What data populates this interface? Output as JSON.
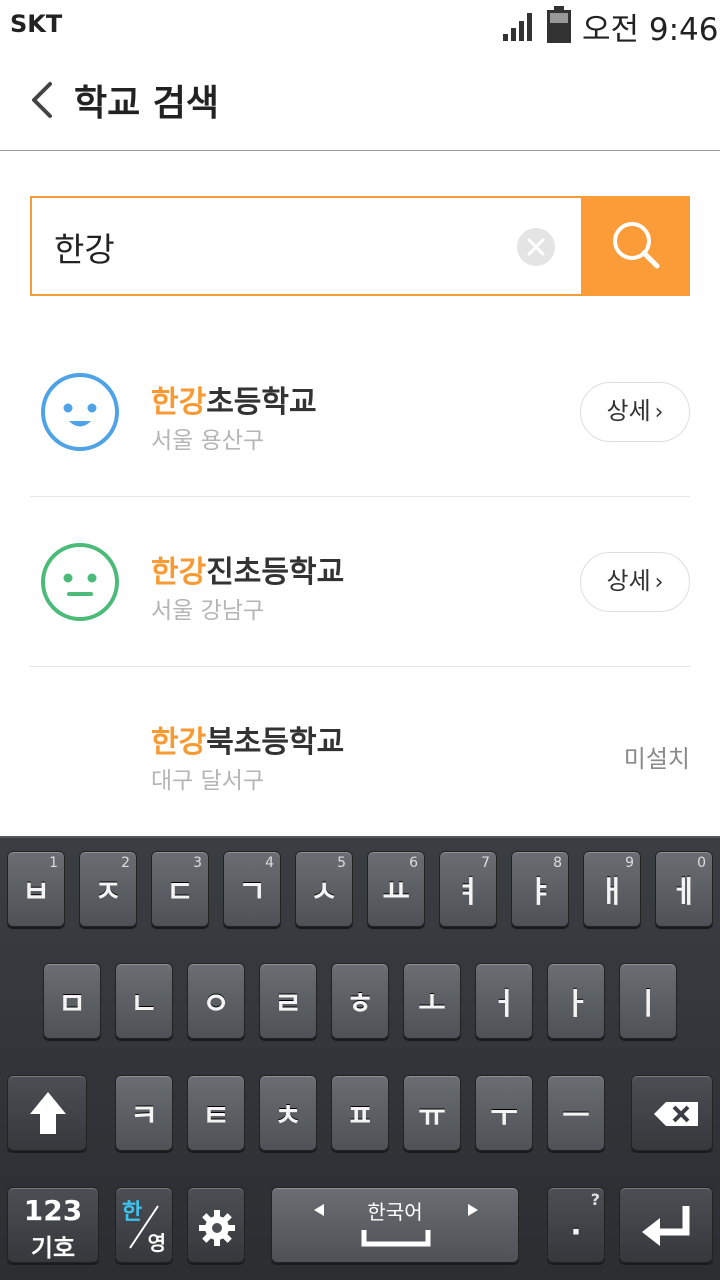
{
  "status_bar": {
    "carrier": "SKT",
    "time": "오전 9:46"
  },
  "header": {
    "title": "학교 검색"
  },
  "search": {
    "value": "한강",
    "placeholder": ""
  },
  "colors": {
    "accent": "#fb9c38",
    "happy_face": "#4ea2e6",
    "neutral_face": "#4cbb7a"
  },
  "results": [
    {
      "highlight": "한강",
      "rest": "초등학교",
      "district": "서울 용산구",
      "icon": "smiley-face-icon",
      "action": "상세",
      "status": ""
    },
    {
      "highlight": "한강",
      "rest": "진초등학교",
      "district": "서울 강남구",
      "icon": "neutral-face-icon",
      "action": "상세",
      "status": ""
    },
    {
      "highlight": "한강",
      "rest": "북초등학교",
      "district": "대구 달서구",
      "icon": "",
      "action": "",
      "status": "미설치"
    }
  ],
  "keyboard": {
    "row1": [
      {
        "label": "ㅂ",
        "num": "1"
      },
      {
        "label": "ㅈ",
        "num": "2"
      },
      {
        "label": "ㄷ",
        "num": "3"
      },
      {
        "label": "ㄱ",
        "num": "4"
      },
      {
        "label": "ㅅ",
        "num": "5"
      },
      {
        "label": "ㅛ",
        "num": "6"
      },
      {
        "label": "ㅕ",
        "num": "7"
      },
      {
        "label": "ㅑ",
        "num": "8"
      },
      {
        "label": "ㅐ",
        "num": "9"
      },
      {
        "label": "ㅔ",
        "num": "0"
      }
    ],
    "row2": [
      "ㅁ",
      "ㄴ",
      "ㅇ",
      "ㄹ",
      "ㅎ",
      "ㅗ",
      "ㅓ",
      "ㅏ",
      "ㅣ"
    ],
    "row3": [
      "ㅋ",
      "ㅌ",
      "ㅊ",
      "ㅍ",
      "ㅠ",
      "ㅜ",
      "ㅡ"
    ],
    "symbols_top": "123",
    "symbols_bottom": "기호",
    "lang_ko": "한",
    "lang_en": "영",
    "space_label": "한국어",
    "period": ".",
    "period_hint": "?"
  }
}
